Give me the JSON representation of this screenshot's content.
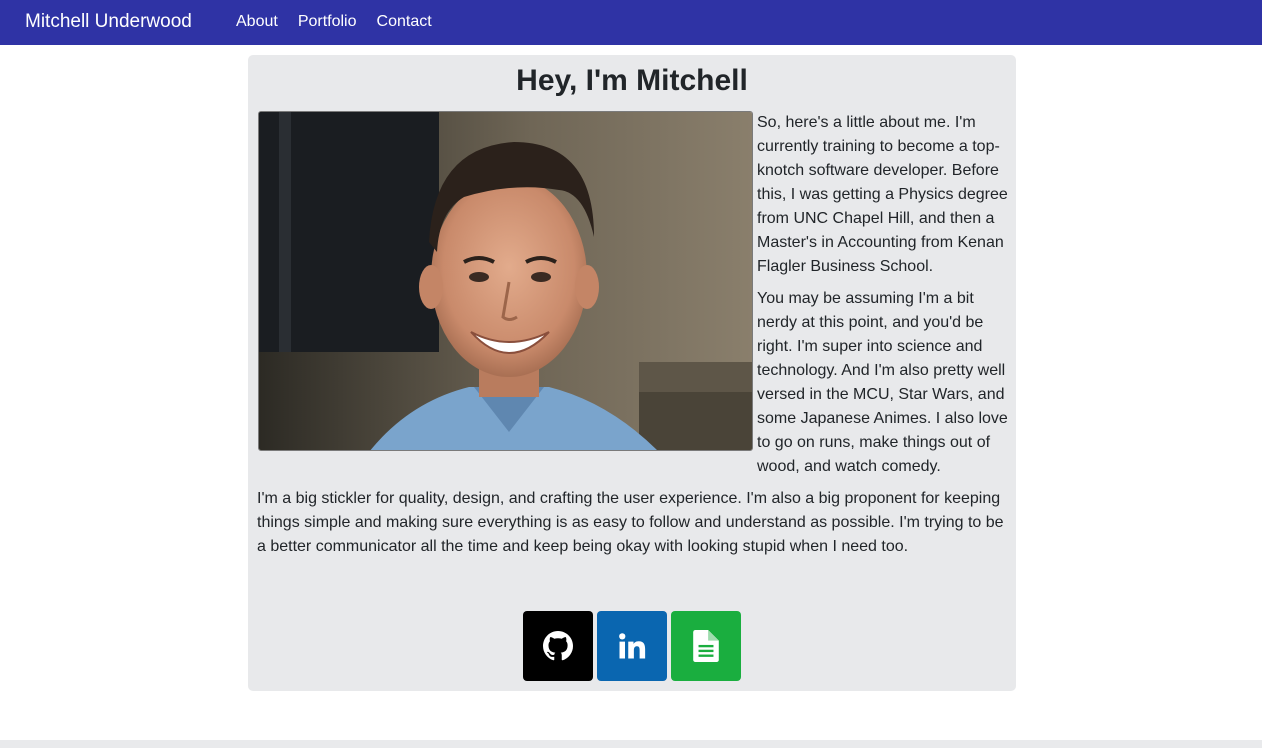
{
  "navbar": {
    "brand": "Mitchell Underwood",
    "links": [
      "About",
      "Portfolio",
      "Contact"
    ],
    "background": "#2f33a5"
  },
  "main": {
    "heading": "Hey, I'm Mitchell",
    "photo": {
      "subject": "portrait photo"
    },
    "paragraphs": [
      "So, here's a little about me. I'm currently training to become a top-knotch software developer. Before this, I was getting a Physics degree from UNC Chapel Hill, and then a Master's in Accounting from Kenan Flagler Business School.",
      "You may be assuming I'm a bit nerdy at this point, and you'd be right. I'm super into science and technology. And I'm also pretty well versed in the MCU, Star Wars, and some Japanese Animes. I also love to go on runs, make things out of wood, and watch comedy.",
      "I'm a big stickler for quality, design, and crafting the user experience. I'm also a big proponent for keeping things simple and making sure everything is as easy to follow and understand as possible. I'm trying to be a better communicator all the time and keep being okay with looking stupid when I need too."
    ],
    "socials": [
      {
        "icon": "github-icon",
        "color": "#000000"
      },
      {
        "icon": "linkedin-icon",
        "color": "#0a66b0"
      },
      {
        "icon": "document-icon",
        "color": "#1aae3f"
      }
    ],
    "card_background": "#e8e9eb"
  }
}
